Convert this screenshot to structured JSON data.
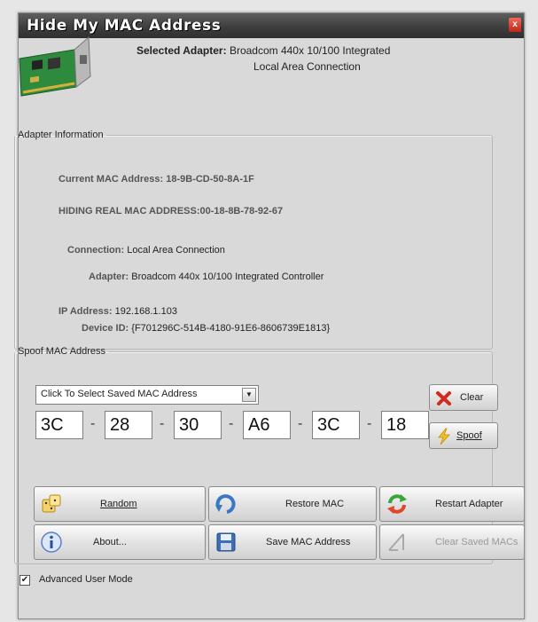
{
  "window": {
    "title": "Hide My MAC Address",
    "close_glyph": "x"
  },
  "header": {
    "selected_label": "Selected Adapter:",
    "adapter_line1": "Broadcom 440x 10/100 Integrated",
    "adapter_line2": "Local Area Connection"
  },
  "adapter_info": {
    "legend": "Adapter Information",
    "current_mac_label": "Current MAC Address:",
    "current_mac_value": "18-9B-CD-50-8A-1F",
    "hiding_label": "HIDING REAL MAC ADDRESS:",
    "hiding_value": "00-18-8B-78-92-67",
    "connection_label": "Connection:",
    "connection_value": "Local Area Connection",
    "adapter_label": "Adapter:",
    "adapter_value": "Broadcom 440x 10/100 Integrated Controller",
    "ip_label": "IP Address:",
    "ip_value": "192.168.1.103",
    "device_label": "Device ID:",
    "device_value": "{F701296C-514B-4180-91E6-8606739E1813}"
  },
  "spoof": {
    "legend": "Spoof MAC Address",
    "select_value": "Click To Select Saved MAC Address",
    "octets": [
      "3C",
      "28",
      "30",
      "A6",
      "3C",
      "18"
    ],
    "separator": "-",
    "clear_label": "Clear",
    "spoof_label": "Spoof"
  },
  "buttons": {
    "random": "Random",
    "restore_mac": "Restore MAC",
    "restart_adapter": "Restart Adapter",
    "about": "About...",
    "save_mac": "Save MAC Address",
    "clear_saved": "Clear Saved MACs"
  },
  "footer": {
    "advanced_mode_label": "Advanced User Mode",
    "advanced_mode_checked": true
  },
  "icons": [
    "network-card-icon",
    "close-icon",
    "red-x-icon",
    "lightning-icon",
    "dice-icon",
    "restore-arrow-icon",
    "restart-arrows-icon",
    "info-icon",
    "floppy-disk-icon",
    "clear-saved-icon",
    "check-icon"
  ]
}
